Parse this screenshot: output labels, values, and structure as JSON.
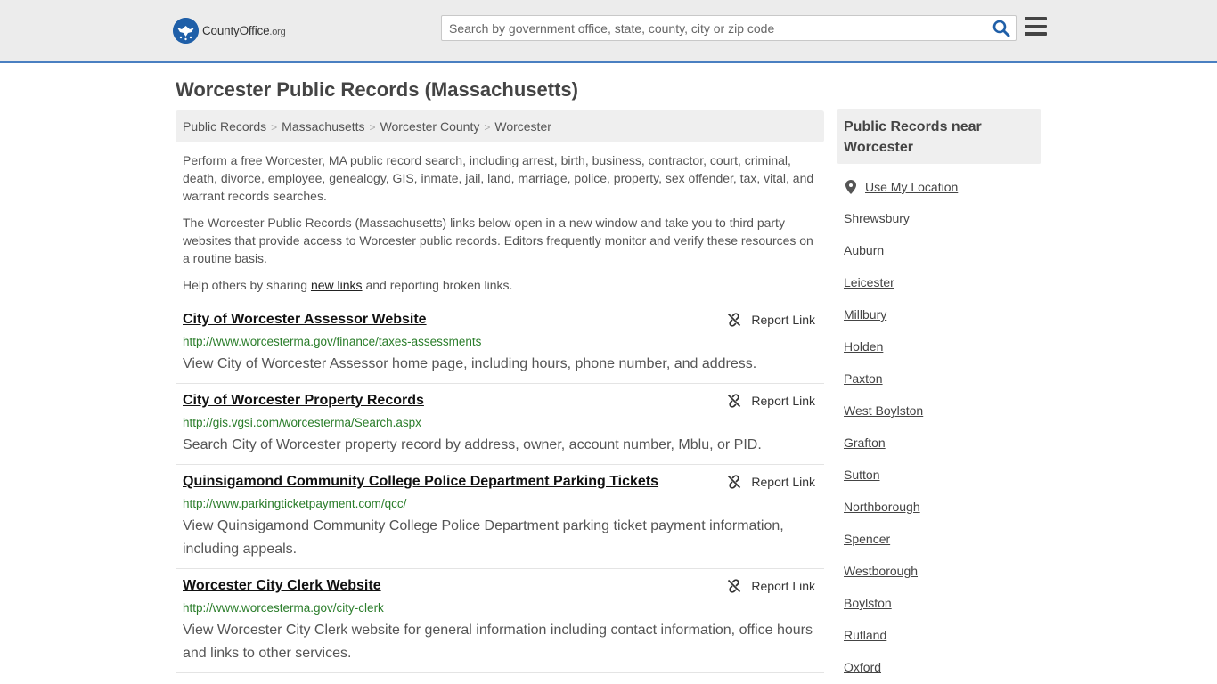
{
  "header": {
    "logo_main": "CountyOffice",
    "logo_suffix": ".org",
    "search_placeholder": "Search by government office, state, county, city or zip code"
  },
  "page": {
    "title": "Worcester Public Records (Massachusetts)"
  },
  "breadcrumb": [
    "Public Records",
    "Massachusetts",
    "Worcester County",
    "Worcester"
  ],
  "intro": {
    "p1": "Perform a free Worcester, MA public record search, including arrest, birth, business, contractor, court, criminal, death, divorce, employee, genealogy, GIS, inmate, jail, land, marriage, police, property, sex offender, tax, vital, and warrant records searches.",
    "p2": "The Worcester Public Records (Massachusetts) links below open in a new window and take you to third party websites that provide access to Worcester public records. Editors frequently monitor and verify these resources on a routine basis.",
    "p3_before": "Help others by sharing ",
    "p3_link": "new links",
    "p3_after": " and reporting broken links."
  },
  "report_label": "Report Link",
  "records": [
    {
      "title": "City of Worcester Assessor Website",
      "url": "http://www.worcesterma.gov/finance/taxes-assessments",
      "desc": "View City of Worcester Assessor home page, including hours, phone number, and address."
    },
    {
      "title": "City of Worcester Property Records",
      "url": "http://gis.vgsi.com/worcesterma/Search.aspx",
      "desc": "Search City of Worcester property record by address, owner, account number, Mblu, or PID."
    },
    {
      "title": "Quinsigamond Community College Police Department Parking Tickets",
      "url": "http://www.parkingticketpayment.com/qcc/",
      "desc": "View Quinsigamond Community College Police Department parking ticket payment information, including appeals."
    },
    {
      "title": "Worcester City Clerk Website",
      "url": "http://www.worcesterma.gov/city-clerk",
      "desc": "View Worcester City Clerk website for general information including contact information, office hours and links to other services."
    }
  ],
  "sidebar": {
    "title": "Public Records near Worcester",
    "location_label": "Use My Location",
    "towns": [
      "Shrewsbury",
      "Auburn",
      "Leicester",
      "Millbury",
      "Holden",
      "Paxton",
      "West Boylston",
      "Grafton",
      "Sutton",
      "Northborough",
      "Spencer",
      "Westborough",
      "Boylston",
      "Rutland",
      "Oxford"
    ]
  },
  "icons": {
    "logo": "eagle-seal-icon",
    "search": "search-icon",
    "menu": "hamburger-menu-icon",
    "report": "broken-link-icon",
    "location": "map-pin-icon"
  },
  "colors": {
    "accent": "#4a7fc1",
    "url_green": "#2a7d2a",
    "search_icon": "#1f5fa8"
  }
}
